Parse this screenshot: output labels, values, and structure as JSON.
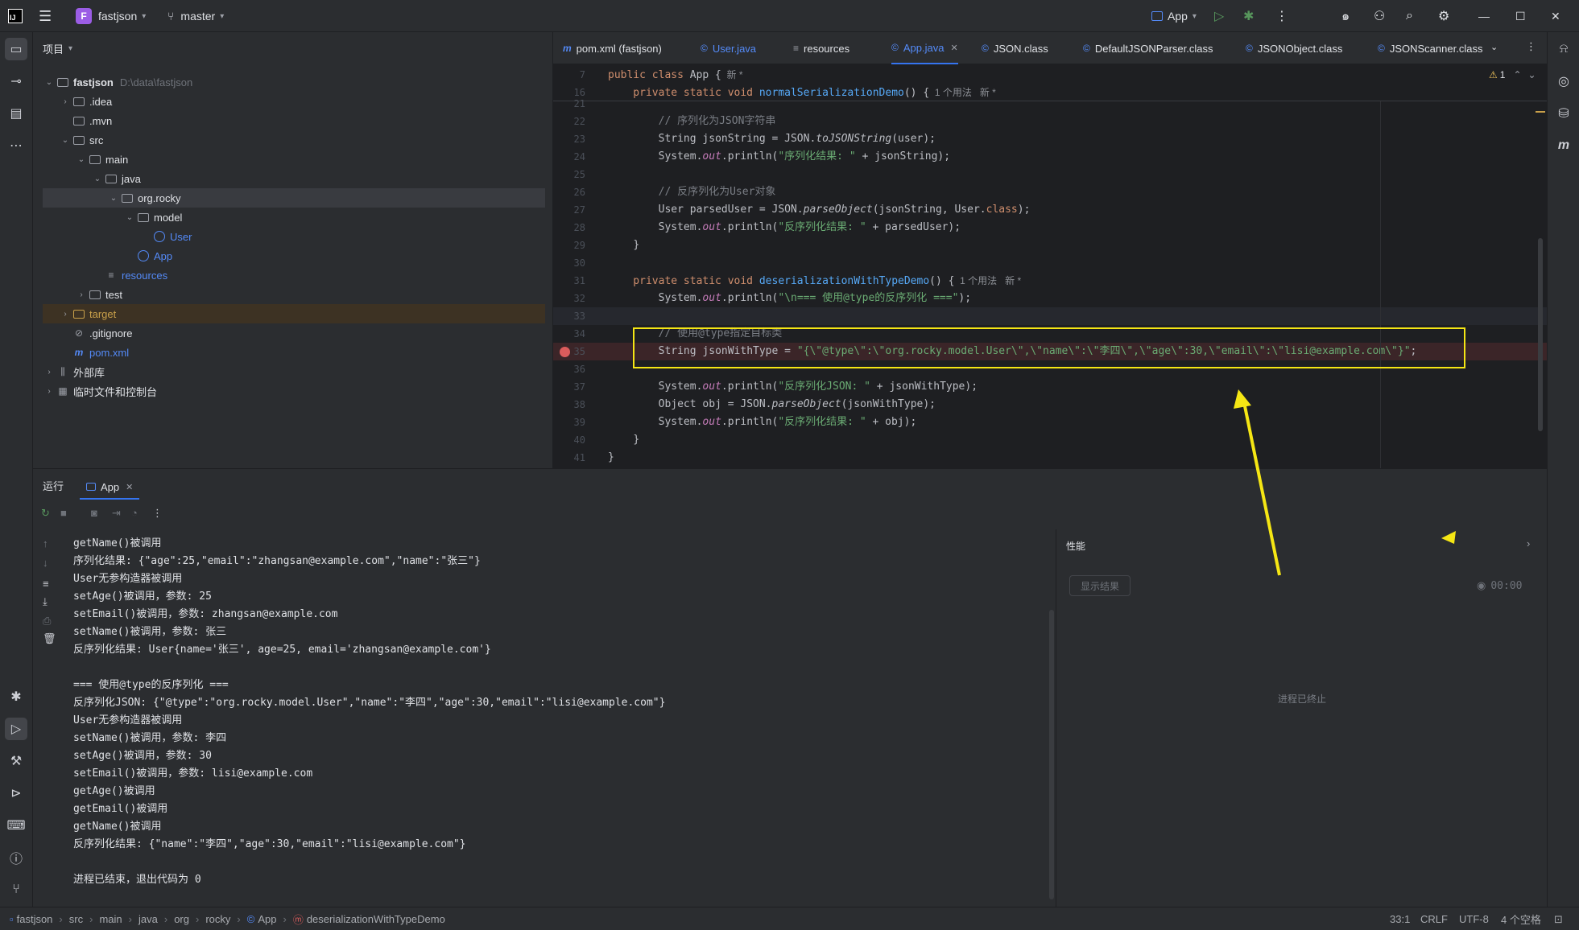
{
  "titlebar": {
    "project_badge": "F",
    "project_name": "fastjson",
    "branch": "master",
    "run_config": "App"
  },
  "project_panel": {
    "title": "项目",
    "tree": [
      {
        "label": "fastjson",
        "extra": "D:\\data\\fastjson",
        "level": 0,
        "type": "module"
      },
      {
        "label": ".idea",
        "level": 1,
        "type": "folder"
      },
      {
        "label": ".mvn",
        "level": 1,
        "type": "folder"
      },
      {
        "label": "src",
        "level": 1,
        "type": "folder"
      },
      {
        "label": "main",
        "level": 2,
        "type": "folder"
      },
      {
        "label": "java",
        "level": 3,
        "type": "folder"
      },
      {
        "label": "org.rocky",
        "level": 4,
        "type": "package"
      },
      {
        "label": "model",
        "level": 5,
        "type": "package"
      },
      {
        "label": "User",
        "level": 6,
        "type": "class"
      },
      {
        "label": "App",
        "level": 5,
        "type": "class"
      },
      {
        "label": "resources",
        "level": 3,
        "type": "resources"
      },
      {
        "label": "test",
        "level": 2,
        "type": "folder"
      },
      {
        "label": "target",
        "level": 1,
        "type": "folder"
      },
      {
        "label": ".gitignore",
        "level": 1,
        "type": "ignore"
      },
      {
        "label": "pom.xml",
        "level": 1,
        "type": "maven"
      },
      {
        "label": "外部库",
        "level": 0,
        "type": "lib"
      },
      {
        "label": "临时文件和控制台",
        "level": 0,
        "type": "scratch"
      }
    ]
  },
  "tabs": [
    {
      "label": "pom.xml (fastjson)"
    },
    {
      "label": "User.java"
    },
    {
      "label": "resources"
    },
    {
      "label": "App.java"
    },
    {
      "label": "JSON.class"
    },
    {
      "label": "DefaultJSONParser.class"
    },
    {
      "label": "JSONObject.class"
    },
    {
      "label": "JSONScanner.class"
    }
  ],
  "editor": {
    "warning_count": "1",
    "sticky": [
      {
        "ln": "7",
        "text": "public class App {",
        "hint": "新 *"
      },
      {
        "ln": "16",
        "text": "    private static void normalSerializationDemo() {",
        "hint": "1 个用法   新 *"
      }
    ],
    "lines": [
      {
        "ln": "21"
      },
      {
        "ln": "22",
        "comment": "// 序列化为JSON字符串"
      },
      {
        "ln": "23",
        "a": "String jsonString = JSON.",
        "b": "toJSONString",
        "c": "(user);"
      },
      {
        "ln": "24",
        "a": "System.",
        "b": "out",
        "c": ".println(",
        "s": "\"序列化结果: \"",
        "d": " + jsonString);"
      },
      {
        "ln": "25"
      },
      {
        "ln": "26",
        "comment": "// 反序列化为User对象"
      },
      {
        "ln": "27",
        "a": "User parsedUser = JSON.",
        "b": "parseObject",
        "c": "(jsonString, User.",
        "k": "class",
        "d": ");"
      },
      {
        "ln": "28",
        "a": "System.",
        "b": "out",
        "c": ".println(",
        "s": "\"反序列化结果: \"",
        "d": " + parsedUser);"
      },
      {
        "ln": "29",
        "brace": "}"
      },
      {
        "ln": "30"
      },
      {
        "ln": "31",
        "decl": "deserializationWithTypeDemo",
        "hint": "1 个用法   新 *"
      },
      {
        "ln": "32",
        "a": "System.",
        "b": "out",
        "c": ".println(",
        "s": "\"\\n=== 使用@type的反序列化 ===\"",
        "d": ");"
      },
      {
        "ln": "33"
      },
      {
        "ln": "34",
        "comment": "// 使用@type指定目标类"
      },
      {
        "ln": "35",
        "a": "String jsonWithType = ",
        "s": "\"{\\\"@type\\\":\\\"org.rocky.model.User\\\",\\\"name\\\":\\\"李四\\\",\\\"age\\\":30,\\\"email\\\":\\\"lisi@example.com\\\"}\"",
        "d": ";"
      },
      {
        "ln": "36"
      },
      {
        "ln": "37",
        "a": "System.",
        "b": "out",
        "c": ".println(",
        "s": "\"反序列化JSON: \"",
        "d": " + jsonWithType);"
      },
      {
        "ln": "38",
        "a": "Object obj = JSON.",
        "b": "parseObject",
        "c": "(jsonWithType);"
      },
      {
        "ln": "39",
        "a": "System.",
        "b": "out",
        "c": ".println(",
        "s": "\"反序列化结果: \"",
        "d": " + obj);"
      },
      {
        "ln": "40",
        "brace": "}"
      },
      {
        "ln": "41",
        "brace0": "}"
      }
    ]
  },
  "run_panel": {
    "title": "运行",
    "tab": "App",
    "console": [
      "getName()被调用",
      "序列化结果: {\"age\":25,\"email\":\"zhangsan@example.com\",\"name\":\"张三\"}",
      "User无参构造器被调用",
      "setAge()被调用，参数: 25",
      "setEmail()被调用，参数: zhangsan@example.com",
      "setName()被调用，参数: 张三",
      "反序列化结果: User{name='张三', age=25, email='zhangsan@example.com'}",
      "",
      "=== 使用@type的反序列化 ===",
      "反序列化JSON: {\"@type\":\"org.rocky.model.User\",\"name\":\"李四\",\"age\":30,\"email\":\"lisi@example.com\"}",
      "User无参构造器被调用",
      "setName()被调用，参数: 李四",
      "setAge()被调用，参数: 30",
      "setEmail()被调用，参数: lisi@example.com",
      "getAge()被调用",
      "getEmail()被调用",
      "getName()被调用",
      "反序列化结果: {\"name\":\"李四\",\"age\":30,\"email\":\"lisi@example.com\"}",
      "",
      "进程已结束，退出代码为 0"
    ],
    "perf_title": "性能",
    "perf_button": "显示结果",
    "perf_time": "00:00",
    "perf_status": "进程已终止"
  },
  "statusbar": {
    "breadcrumb": [
      "fastjson",
      "src",
      "main",
      "java",
      "org",
      "rocky",
      "App",
      "deserializationWithTypeDemo"
    ],
    "position": "33:1",
    "line_sep": "CRLF",
    "encoding": "UTF-8",
    "indent": "4 个空格"
  },
  "colors": {
    "accent": "#3574f0",
    "annotation": "#f5e614",
    "breakpoint": "#db5c5c"
  }
}
